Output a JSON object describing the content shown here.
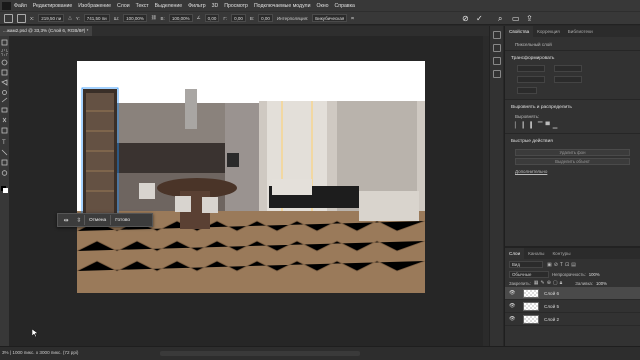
{
  "menu": [
    "Файл",
    "Редактирование",
    "Изображение",
    "Слои",
    "Текст",
    "Выделение",
    "Фильтр",
    "3D",
    "Просмотр",
    "Подключаемые модули",
    "Окно",
    "Справка"
  ],
  "options": {
    "x_value": "219,50 пи",
    "y_value": "741,50 пи",
    "w_value": "100,00%",
    "h_value": "100,00%",
    "angle_value": "0,00",
    "skew_h": "0,00",
    "skew_v": "0,00",
    "interp_label": "Интерполяция:",
    "interp_value": "Бикубическая"
  },
  "document_tab": "...жам2.psd @ 33,3% (Слой 6, RGB/8#) *",
  "right_panel": {
    "tabs": [
      "Свойства",
      "Коррекция",
      "Библиотеки"
    ],
    "layer_kind": "Пиксельный слой",
    "transform_title": "Трансформировать",
    "align_title": "Выровнять и распределить",
    "align_sub": "Выровнять:",
    "quick_title": "Быстрые действия",
    "btn_remove_bg": "Удалить фон",
    "btn_select_subject": "Выделить объект",
    "more_link": "Дополнительно"
  },
  "layers_panel": {
    "tabs": [
      "Слои",
      "Каналы",
      "Контуры"
    ],
    "kind": "Вид",
    "blend": "Обычные",
    "opacity_label": "Непрозрачность:",
    "opacity_value": "100%",
    "lock_label": "Закрепить:",
    "fill_label": "Заливка:",
    "fill_value": "100%",
    "layers": [
      {
        "name": "Слой 6",
        "active": true
      },
      {
        "name": "Слой 5",
        "active": false
      },
      {
        "name": "Слой 2",
        "active": false
      }
    ]
  },
  "popup": {
    "cancel": "Отмена",
    "done": "Готово"
  },
  "status": "3% | 1000 пикс. x 3000 пикс. (72 ppi)"
}
